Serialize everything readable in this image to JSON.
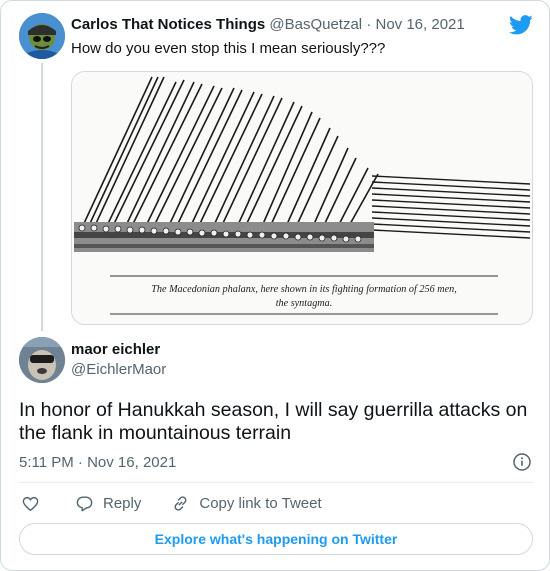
{
  "quoted_tweet": {
    "display_name": "Carlos That Notices Things",
    "handle": "@BasQuetzal",
    "separator": " · ",
    "date": "Nov 16, 2021",
    "text": "How do you even stop this I mean seriously???",
    "image": {
      "caption_line1": "The Macedonian phalanx, here shown in its fighting formation of 256 men,",
      "caption_line2": "the syntagma."
    }
  },
  "tweet": {
    "display_name": "maor eichler",
    "handle": "@EichlerMaor",
    "text": "In honor of Hanukkah season, I will say guerrilla attacks on the flank in mountainous terrain",
    "timestamp": "5:11 PM · Nov 16, 2021"
  },
  "actions": {
    "reply_label": "Reply",
    "copy_link_label": "Copy link to Tweet"
  },
  "explore_label": "Explore what's happening on Twitter",
  "colors": {
    "accent": "#1d9bf0",
    "secondary_text": "#536471",
    "border": "#cfd9de"
  },
  "icons": [
    "twitter-bird-icon",
    "info-icon",
    "heart-icon",
    "reply-icon",
    "link-icon"
  ]
}
